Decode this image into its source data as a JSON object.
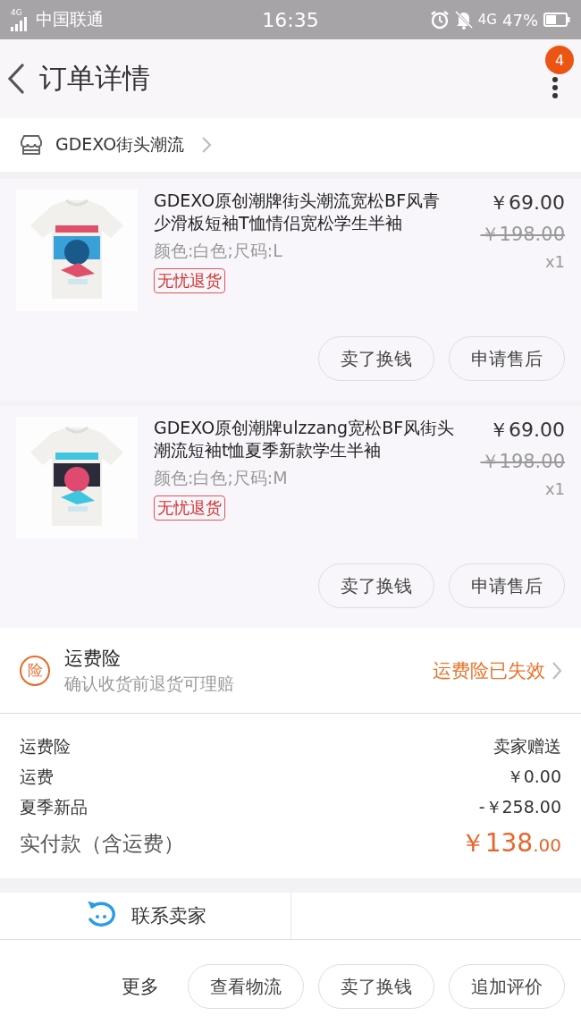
{
  "status_bar": {
    "signal_label": "4G",
    "carrier": "中国联通",
    "time": "16:35",
    "network": "4G",
    "battery": "47%"
  },
  "header": {
    "title": "订单详情",
    "badge": "4"
  },
  "shop": {
    "name": "GDEXO街头潮流"
  },
  "items": [
    {
      "title": "GDEXO原创潮牌街头潮流宽松BF风青少滑板短袖T恤情侣宽松学生半袖",
      "variant": "颜色:白色;尺码:L",
      "tag": "无忧退货",
      "price": "￥69.00",
      "original_price": "￥198.00",
      "quantity": "x1",
      "actions": [
        "卖了换钱",
        "申请售后"
      ]
    },
    {
      "title": "GDEXO原创潮牌ulzzang宽松BF风街头潮流短袖t恤夏季新款学生半袖",
      "variant": "颜色:白色;尺码:M",
      "tag": "无忧退货",
      "price": "￥69.00",
      "original_price": "￥198.00",
      "quantity": "x1",
      "actions": [
        "卖了换钱",
        "申请售后"
      ]
    }
  ],
  "insurance": {
    "icon_text": "险",
    "title": "运费险",
    "subtitle": "确认收货前退货可理赔",
    "status": "运费险已失效"
  },
  "summary": {
    "rows": [
      {
        "label": "运费险",
        "value": "卖家赠送"
      },
      {
        "label": "运费",
        "value": "￥0.00"
      },
      {
        "label": "夏季新品",
        "value": "-￥258.00"
      }
    ],
    "total": {
      "label": "实付款（含运费）",
      "amount_main": "￥138",
      "amount_cents": ".00"
    }
  },
  "contact": {
    "label": "联系卖家"
  },
  "bottom_bar": {
    "more": "更多",
    "buttons": [
      "查看物流",
      "卖了换钱",
      "追加评价"
    ]
  }
}
